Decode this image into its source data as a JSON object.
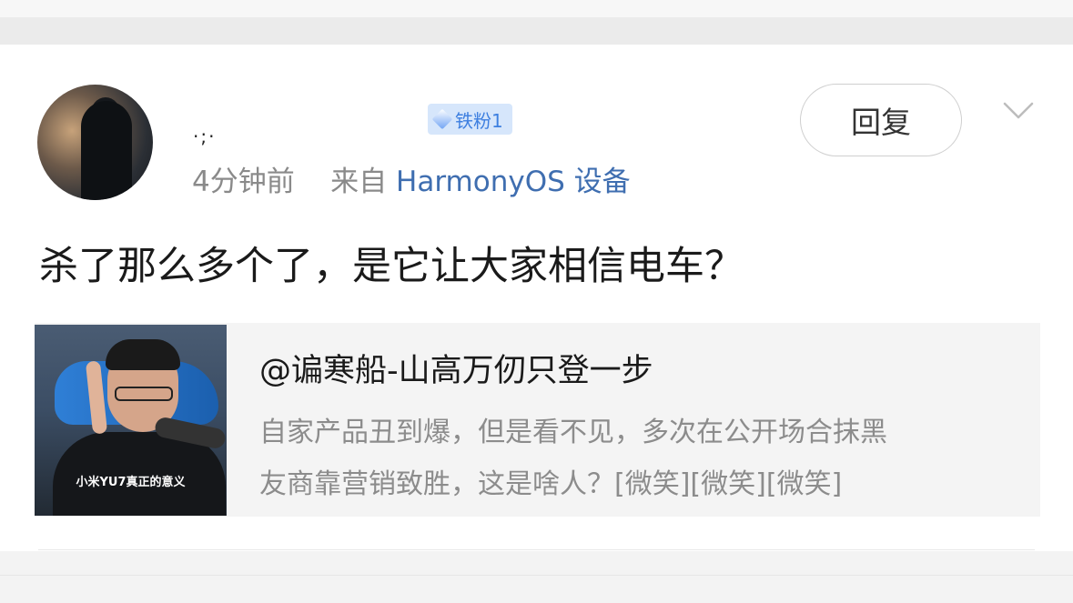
{
  "comment": {
    "username": "·;·",
    "fan_badge": {
      "label": "铁粉1",
      "icon": "diamond-icon",
      "color": "#3d7fe0"
    },
    "meta": {
      "time": "4分钟前",
      "from_label": "来自",
      "device": "HarmonyOS 设备"
    },
    "reply_label": "回复",
    "text": "杀了那么多个了，是它让大家相信电车？"
  },
  "quote": {
    "author": "@谝寒船-山高万仞只登一步",
    "lines": [
      "自家产品丑到爆，但是看不见，多次在公开场合抹黑",
      "友商靠营销致胜，这是啥人？[微笑][微笑][微笑]"
    ],
    "thumbnail_caption": "小米YU7真正的意义"
  },
  "colors": {
    "link_blue": "#3f6eb0",
    "muted": "#8a8a8a",
    "card_bg": "#f4f4f4"
  }
}
